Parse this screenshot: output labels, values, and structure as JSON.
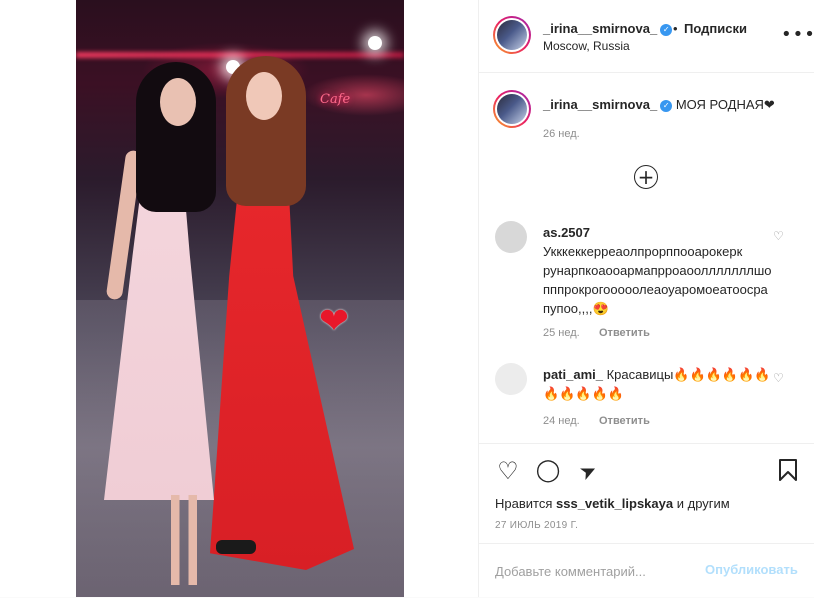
{
  "header": {
    "username": "_irina__smirnova_",
    "follow_label": "Подписки",
    "location": "Moscow, Russia",
    "more_glyph": "•••"
  },
  "caption": {
    "username": "_irina__smirnova_",
    "text": "МОЯ РОДНАЯ❤",
    "age": "26 нед."
  },
  "photo": {
    "sticker": "❤",
    "sign_text": "Cafe"
  },
  "load_more_glyph": "+",
  "comments": [
    {
      "username": "as.2507",
      "text": "Укккеккерреаолпрорппооарокерк рунарпкоаооармапрроаоолллллллшопппрокрогооооолеаоуаромоеатоосрапупоо,,,,😍",
      "age": "25 нед.",
      "reply": "Ответить"
    },
    {
      "username": "pati_ami_",
      "text": "Красавицы🔥🔥🔥🔥🔥🔥🔥🔥🔥🔥🔥",
      "age": "24 нед.",
      "reply": "Ответить"
    }
  ],
  "actions": {
    "like_glyph": "♡",
    "comment_glyph": "◯",
    "share_glyph": "➤",
    "save_glyph": "⊓"
  },
  "likes": {
    "prefix": "Нравится",
    "user": "sss_vetik_lipskaya",
    "suffix": "и другим"
  },
  "date": "27 ИЮЛЬ 2019 Г.",
  "add_comment": {
    "placeholder": "Добавьте комментарий...",
    "post_label": "Опубликовать"
  },
  "colors": {
    "link_disabled": "#b2dffc",
    "verified": "#3897f0",
    "muted": "#8e8e8e",
    "text": "#262626"
  }
}
